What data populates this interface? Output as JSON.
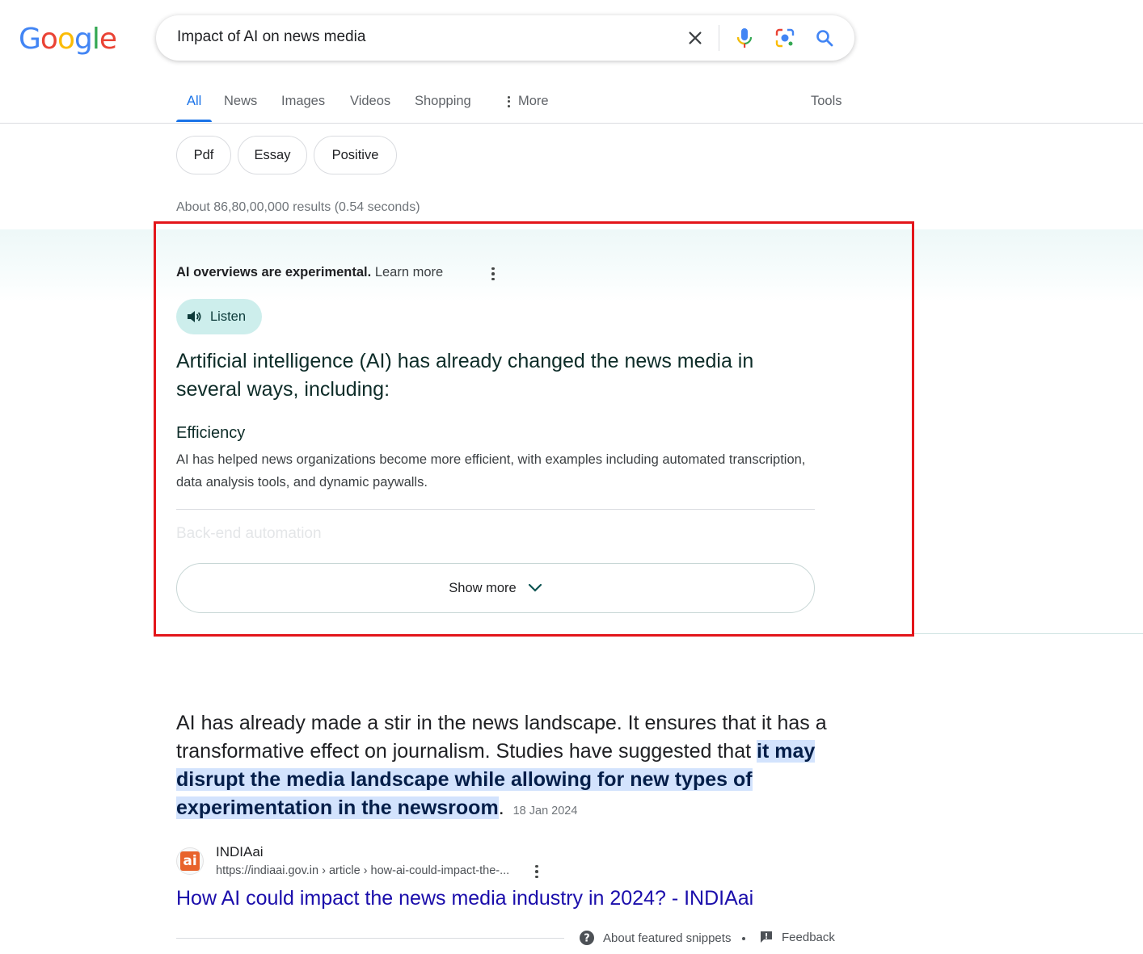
{
  "logo": {
    "letters": [
      "G",
      "o",
      "o",
      "g",
      "l",
      "e"
    ],
    "colors": [
      "#4285F4",
      "#EA4335",
      "#FBBC05",
      "#4285F4",
      "#34A853",
      "#EA4335"
    ]
  },
  "search": {
    "query": "Impact of AI on news media"
  },
  "tabs": [
    {
      "label": "All",
      "active": true
    },
    {
      "label": "News"
    },
    {
      "label": "Images"
    },
    {
      "label": "Videos"
    },
    {
      "label": "Shopping"
    },
    {
      "label": "More"
    }
  ],
  "tools_label": "Tools",
  "chips": [
    "Pdf",
    "Essay",
    "Positive"
  ],
  "result_stats": "About 86,80,00,000 results (0.54 seconds)",
  "ai_overview": {
    "experimental_text": "AI overviews are experimental.",
    "learn_more": "Learn more",
    "listen_label": "Listen",
    "heading": "Artificial intelligence (AI) has already changed the news media in several ways, including:",
    "section_title": "Efficiency",
    "section_body": "AI has helped news organizations become more efficient, with examples including automated transcription, data analysis tools, and dynamic paywalls.",
    "faded_title": "Back-end automation",
    "show_more_label": "Show more"
  },
  "featured_snippet": {
    "text_before": "AI has already made a stir in the news landscape. It ensures that it has a transformative effect on journalism. Studies have suggested that ",
    "text_highlight": "it may disrupt the media landscape while allowing for new types of experimentation in the newsroom",
    "text_after": ".",
    "date": "18 Jan 2024",
    "site_logo_text": "ai",
    "site_name": "INDIAai",
    "site_url": "https://indiaai.gov.in › article › how-ai-could-impact-the-...",
    "title": "How AI could impact the news media industry in 2024? - INDIAai",
    "about_label": "About featured snippets",
    "feedback_label": "Feedback"
  },
  "colors": {
    "accent": "#1a73e8",
    "link": "#1a0dab",
    "highlight_box": "#e3151a",
    "listen_bg": "#cdeeec"
  }
}
